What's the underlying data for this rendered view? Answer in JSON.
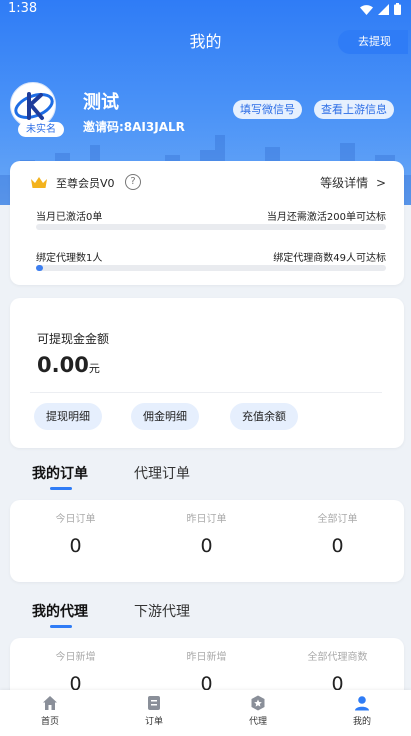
{
  "status_bar": {
    "time": "1:38"
  },
  "page": {
    "title": "我的"
  },
  "user": {
    "name": "测试",
    "invite_code": "邀请码:8AI3JALR",
    "realname_badge": "未实名",
    "fill_wechat_label": "填写微信号",
    "view_upstream_label": "查看上游信息"
  },
  "membership": {
    "title": "至尊会员V0",
    "level_detail_label": "等级详情",
    "level_detail_arrow": ">",
    "activated_text": "当月已激活0单",
    "remaining_text": "当月还需激活200单可达标",
    "activation_progress": 0,
    "bound_agents_text": "绑定代理数1人",
    "bound_remaining_text": "绑定代理商数49人可达标",
    "bound_progress": 0.02
  },
  "withdraw": {
    "label": "可提现金金额",
    "amount": "0.00",
    "unit": "元",
    "button_label": "去提现",
    "actions": [
      "提现明细",
      "佣金明细",
      "充值余额"
    ]
  },
  "orders": {
    "tabs": [
      "我的订单",
      "代理订单"
    ],
    "active_tab": 0,
    "stats": [
      {
        "label": "今日订单",
        "value": "0"
      },
      {
        "label": "昨日订单",
        "value": "0"
      },
      {
        "label": "全部订单",
        "value": "0"
      }
    ]
  },
  "agents": {
    "tabs": [
      "我的代理",
      "下游代理"
    ],
    "active_tab": 0,
    "stats": [
      {
        "label": "今日新增",
        "value": "0"
      },
      {
        "label": "昨日新增",
        "value": "0"
      },
      {
        "label": "全部代理商数",
        "value": "0"
      }
    ]
  },
  "bottom_nav": {
    "items": [
      {
        "label": "首页",
        "icon": "home-icon"
      },
      {
        "label": "订单",
        "icon": "order-icon"
      },
      {
        "label": "代理",
        "icon": "agent-icon"
      },
      {
        "label": "我的",
        "icon": "profile-icon"
      }
    ],
    "active_index": 3
  },
  "colors": {
    "primary": "#2f7cf6",
    "chip_bg": "#e6effd",
    "page_bg": "#eef2f7"
  }
}
